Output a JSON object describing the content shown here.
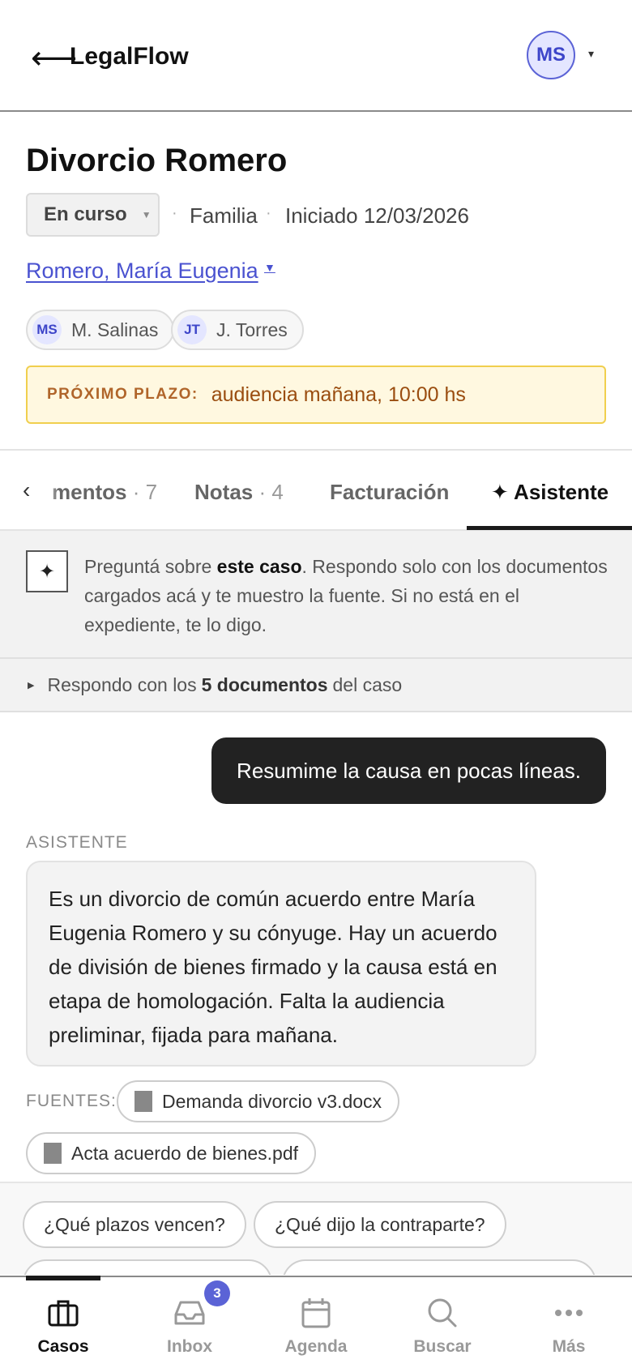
{
  "header": {
    "back_glyph": "⟵",
    "brand": "LegalFlow",
    "avatar_initials": "MS",
    "avatar_caret": "▾"
  },
  "case": {
    "title": "Divorcio Romero",
    "status": "En curso",
    "area": "Familia",
    "started": "Iniciado 12/03/2026",
    "client": "Romero, María Eugenia",
    "team": [
      {
        "initials": "MS",
        "name": "M. Salinas"
      },
      {
        "initials": "JT",
        "name": "J. Torres"
      }
    ],
    "deadline_label": "PRÓXIMO PLAZO:",
    "deadline_value": "audiencia mañana, 10:00 hs"
  },
  "tabs": [
    {
      "label": "mentos",
      "count": "· 7"
    },
    {
      "label": "Notas",
      "count": "· 4"
    },
    {
      "label": "Facturación",
      "count": ""
    },
    {
      "label": "✦ Asistente",
      "count": ""
    }
  ],
  "assistant": {
    "intro_prefix": "Preguntá sobre ",
    "intro_bold": "este caso",
    "intro_suffix": ". Respondo solo con los documentos cargados acá y te muestro la fuente. Si no está en el expediente, te lo digo.",
    "scope_prefix": "Respondo con los",
    "scope_bold": "5 documentos",
    "scope_suffix": "del caso"
  },
  "chat": {
    "user_message": "Resumime la causa en pocas líneas.",
    "assistant_label": "ASISTENTE",
    "assistant_message": "Es un divorcio de común acuerdo entre María Eugenia Romero y su cónyuge. Hay un acuerdo de división de bienes firmado y la causa está en etapa de homologación. Falta la audiencia preliminar, fijada para mañana.",
    "sources_label": "FUENTES:",
    "sources": [
      "Demanda divorcio v3.docx",
      "Acta acuerdo de bienes.pdf"
    ]
  },
  "suggestions": [
    "¿Qué plazos vencen?",
    "¿Qué dijo la contraparte?"
  ],
  "nav": {
    "items": [
      "Casos",
      "Inbox",
      "Agenda",
      "Buscar",
      "Más"
    ],
    "inbox_badge": "3",
    "active": "Casos"
  }
}
